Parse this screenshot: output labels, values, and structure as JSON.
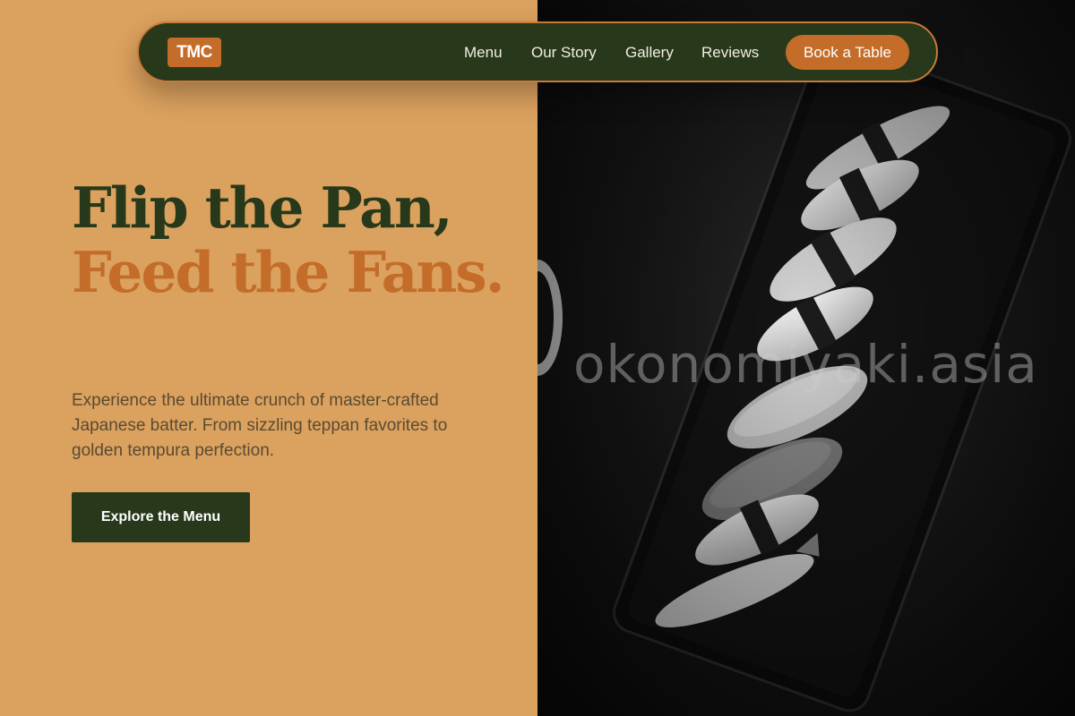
{
  "brand": {
    "logo": "TMC"
  },
  "nav": {
    "links": [
      "Menu",
      "Our Story",
      "Gallery",
      "Reviews"
    ],
    "cta": "Book a Table"
  },
  "hero": {
    "headline_line1": "Flip the Pan,",
    "headline_line2": "Feed the Fans.",
    "subtext": "Experience the ultimate crunch of master-crafted Japanese batter. From sizzling teppan favorites to golden tempura perfection.",
    "cta": "Explore the Menu"
  },
  "image": {
    "watermark": "okonomiyaki.asia"
  },
  "colors": {
    "background": "#DBA15E",
    "dark_green": "#27391A",
    "accent_orange": "#C46D2A"
  }
}
